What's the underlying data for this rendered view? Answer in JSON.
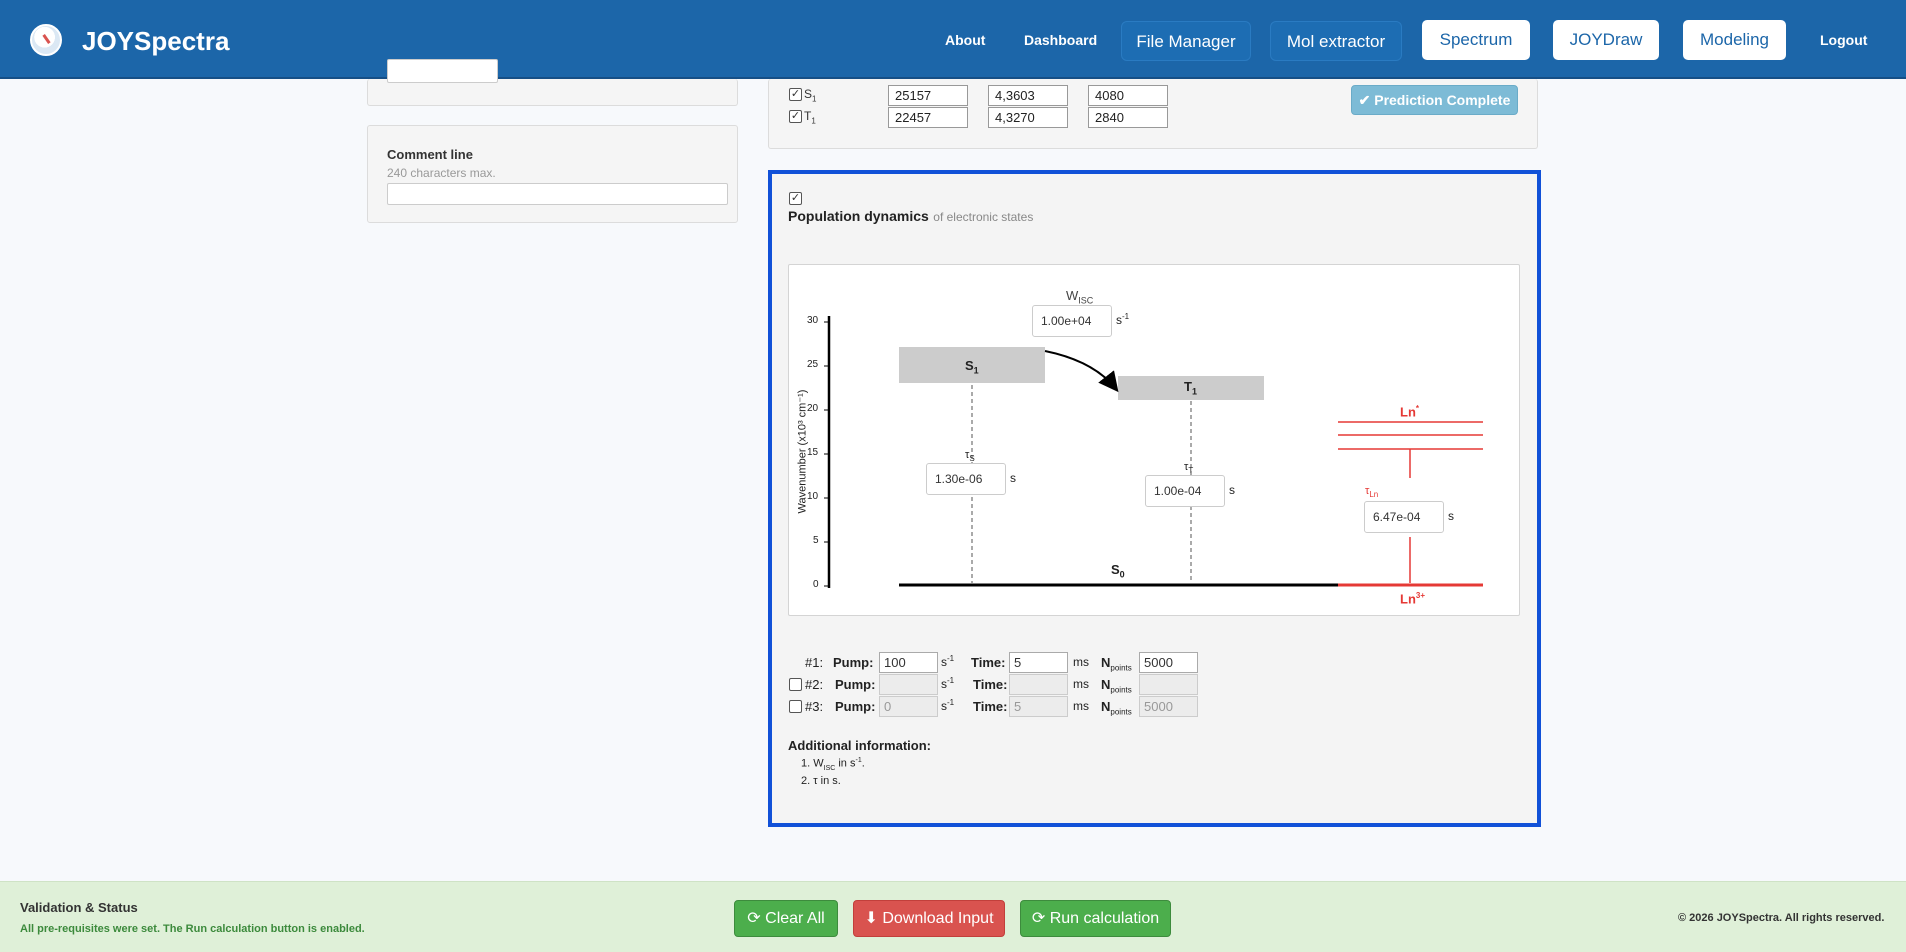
{
  "app": {
    "brand": "JOYSpectra"
  },
  "nav": {
    "about": "About",
    "dashboard": "Dashboard",
    "file_manager": "File Manager",
    "mol_extractor": "Mol extractor",
    "spectrum": "Spectrum",
    "joydraw": "JOYDraw",
    "modeling": "Modeling",
    "logout": "Logout"
  },
  "comment": {
    "label": "Comment line",
    "hint": "240 characters max.",
    "value": ""
  },
  "states": {
    "rows": [
      {
        "name": "S",
        "sub": "1",
        "e": "25157",
        "rl": "4,3603",
        "fwhm": "4080",
        "checked": "✓"
      },
      {
        "name": "T",
        "sub": "1",
        "e": "22457",
        "rl": "4,3270",
        "fwhm": "2840",
        "checked": "✓"
      }
    ],
    "prediction_status": "✔ Prediction Complete"
  },
  "population": {
    "checkbox": "✓",
    "title": "Population dynamics",
    "subtitle": "of electronic states"
  },
  "diagram": {
    "y_label": "Wavenumber (x10³ cm⁻¹)",
    "y_ticks": [
      "30",
      "25",
      "20",
      "15",
      "10",
      "5",
      "0"
    ],
    "s1": {
      "name": "S",
      "sub": "1"
    },
    "t1": {
      "name": "T",
      "sub": "1"
    },
    "s0": {
      "name": "S",
      "sub": "0"
    },
    "ln_star": {
      "name": "Ln",
      "sup": "*"
    },
    "ln3": {
      "name": "Ln",
      "sup": "3+"
    },
    "w_isc": {
      "name": "W",
      "sub": "ISC",
      "value": "1.00e+04",
      "unit": "s",
      "unit_sup": "-1"
    },
    "tau_s": {
      "name": "τ",
      "sub": "S",
      "value": "1.30e-06",
      "unit": "s"
    },
    "tau_t": {
      "name": "τ",
      "sub": "T",
      "value": "1.00e-04",
      "unit": "s"
    },
    "tau_ln": {
      "name": "τ",
      "sub": "Ln",
      "value": "6.47e-04",
      "unit": "s"
    }
  },
  "pumps": [
    {
      "index": "#1:",
      "pump": "100",
      "time": "5",
      "npoints": "5000",
      "enabled": true,
      "checkbox": false
    },
    {
      "index": "#2:",
      "pump": "",
      "time": "",
      "npoints": "",
      "enabled": false,
      "checkbox": true
    },
    {
      "index": "#3:",
      "pump": "0",
      "time": "5",
      "npoints": "5000",
      "enabled": false,
      "checkbox": true
    }
  ],
  "pump_labels": {
    "pump": "Pump:",
    "pump_unit": "s",
    "pump_unit_sup": "-1",
    "time": "Time:",
    "time_unit": "ms",
    "npoints": "N",
    "npoints_sub": "points"
  },
  "additional": {
    "title": "Additional information:",
    "item1_prefix": "1. W",
    "item1_sub": "ISC",
    "item1_mid": " in s",
    "item1_sup": "-1",
    "item1_end": ".",
    "item2": "2. τ in s."
  },
  "footer": {
    "title": "Validation & Status",
    "message": "All pre-requisites were set. The Run calculation button is enabled.",
    "clear": "⟳ Clear All",
    "download": "⬇ Download Input",
    "run": "⟳ Run calculation",
    "copyright": "© 2026 JOYSpectra. All rights reserved."
  },
  "colors": {
    "nav": "#1c66a9",
    "highlight_border": "#1151d8",
    "ln_red": "#e53935",
    "btn_green": "#4cae4c",
    "btn_red": "#d9534f"
  }
}
